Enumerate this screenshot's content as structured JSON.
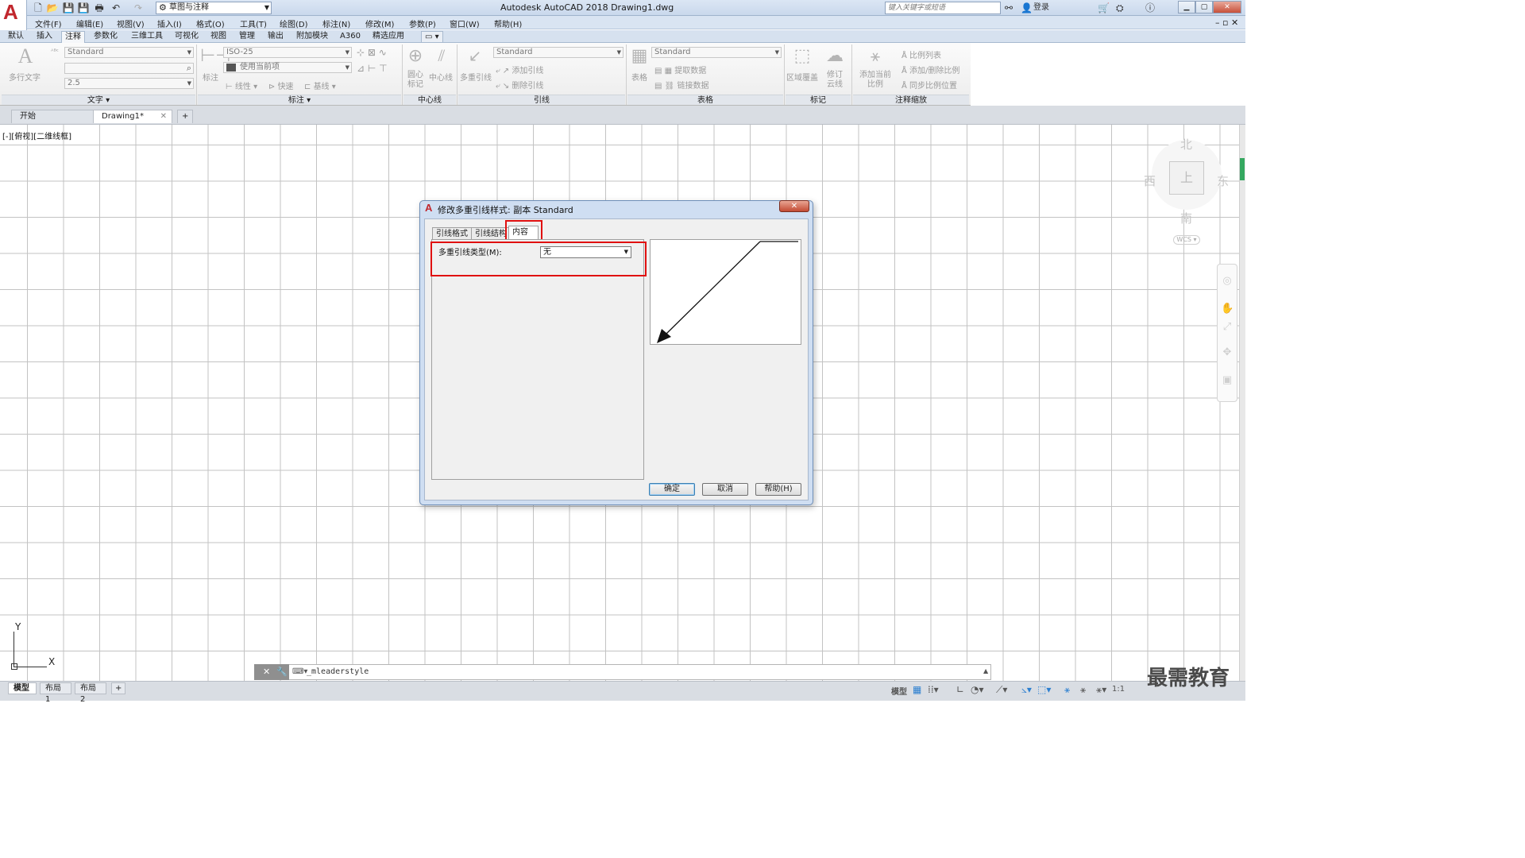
{
  "app": {
    "title": "Autodesk AutoCAD 2018    Drawing1.dwg",
    "logo_letter": "A",
    "workspace": "草图与注释",
    "search_placeholder": "键入关键字或短语",
    "login": "登录"
  },
  "menu": [
    "文件(F)",
    "编辑(E)",
    "视图(V)",
    "插入(I)",
    "格式(O)",
    "工具(T)",
    "绘图(D)",
    "标注(N)",
    "修改(M)",
    "参数(P)",
    "窗口(W)",
    "帮助(H)"
  ],
  "ribbon_tabs": [
    "默认",
    "插入",
    "注释",
    "参数化",
    "三维工具",
    "可视化",
    "视图",
    "管理",
    "输出",
    "附加模块",
    "A360",
    "精选应用"
  ],
  "ribbon": {
    "text_panel": {
      "title": "文字",
      "big_button": "多行文字",
      "style": "Standard",
      "height": "2.5"
    },
    "dim_panel": {
      "title": "标注",
      "big_button": "标注",
      "style": "ISO-25",
      "layer": "使用当前项",
      "linear": "线性",
      "quick": "快速",
      "baseline": "基线"
    },
    "centerline_panel": {
      "title": "中心线",
      "center_mark": "圆心标记",
      "centerline": "中心线"
    },
    "leader_panel": {
      "title": "引线",
      "big_button": "多重引线",
      "style": "Standard",
      "add": "添加引线",
      "remove": "删除引线"
    },
    "table_panel": {
      "title": "表格",
      "big_button": "表格",
      "style": "Standard",
      "extract": "提取数据",
      "link": "链接数据"
    },
    "markup_panel": {
      "title": "标记",
      "wipeout": "区域覆盖",
      "revcloud": "修订云线"
    },
    "scale_panel": {
      "title": "注释缩放",
      "add_scale": "添加当前比例",
      "list": "比例列表",
      "add_delete": "添加/删除比例",
      "sync": "同步比例位置"
    }
  },
  "doc_tabs": [
    "开始",
    "Drawing1*"
  ],
  "viewport_label": "[-][俯视][二维线框]",
  "viewcube": {
    "north": "北",
    "south": "南",
    "east": "东",
    "west": "西",
    "face": "上",
    "wcs": "WCS"
  },
  "ucs": {
    "x": "X",
    "y": "Y"
  },
  "command_line": "_mleaderstyle",
  "layout_tabs": [
    "模型",
    "布局1",
    "布局2"
  ],
  "status": {
    "model": "模型",
    "scale": "1:1"
  },
  "watermark": "最需教育",
  "dialog": {
    "title": "修改多重引线样式: 副本 Standard",
    "tabs": [
      "引线格式",
      "引线结构",
      "内容"
    ],
    "active_tab": "内容",
    "mleader_type_label": "多重引线类型(M):",
    "mleader_type_value": "无",
    "buttons": {
      "ok": "确定",
      "cancel": "取消",
      "help": "帮助(H)"
    }
  }
}
